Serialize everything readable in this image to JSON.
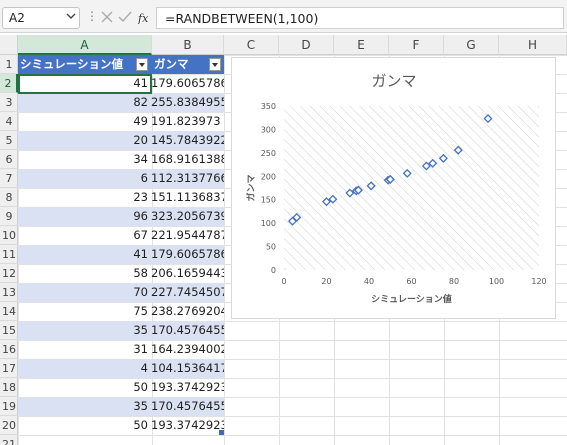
{
  "formula_bar": {
    "name_box": "A2",
    "dots": "⋮",
    "formula": "=RANDBETWEEN(1,100)"
  },
  "columns": [
    "A",
    "B",
    "C",
    "D",
    "E",
    "F",
    "G",
    "H"
  ],
  "rows": [
    "1",
    "2",
    "3",
    "4",
    "5",
    "6",
    "7",
    "8",
    "9",
    "10",
    "11",
    "12",
    "13",
    "14",
    "15",
    "16",
    "17",
    "18",
    "19",
    "20",
    "21"
  ],
  "table": {
    "headers": [
      "シミュレーション値",
      "ガンマ"
    ],
    "rows": [
      [
        "41",
        "179.6065786"
      ],
      [
        "82",
        "255.8384955"
      ],
      [
        "49",
        "191.823973"
      ],
      [
        "20",
        "145.7843922"
      ],
      [
        "34",
        "168.9161388"
      ],
      [
        "6",
        "112.3137766"
      ],
      [
        "23",
        "151.1136837"
      ],
      [
        "96",
        "323.2056739"
      ],
      [
        "67",
        "221.9544787"
      ],
      [
        "41",
        "179.6065786"
      ],
      [
        "58",
        "206.1659443"
      ],
      [
        "70",
        "227.7454507"
      ],
      [
        "75",
        "238.2769204"
      ],
      [
        "35",
        "170.4576455"
      ],
      [
        "31",
        "164.2394002"
      ],
      [
        "4",
        "104.1536417"
      ],
      [
        "50",
        "193.3742923"
      ],
      [
        "35",
        "170.4576455"
      ],
      [
        "50",
        "193.3742923"
      ]
    ]
  },
  "chart_data": {
    "type": "scatter",
    "title": "ガンマ",
    "xlabel": "シミュレーション値",
    "ylabel": "ガンマ",
    "xlim": [
      0,
      120
    ],
    "ylim": [
      0,
      350
    ],
    "xticks": [
      0,
      20,
      40,
      60,
      80,
      100,
      120
    ],
    "yticks": [
      0,
      50,
      100,
      150,
      200,
      250,
      300,
      350
    ],
    "grid": "diagonal-hatch",
    "marker_color": "#4472c4",
    "points": [
      [
        41,
        179.6
      ],
      [
        82,
        255.8
      ],
      [
        49,
        191.8
      ],
      [
        20,
        145.8
      ],
      [
        34,
        168.9
      ],
      [
        6,
        112.3
      ],
      [
        23,
        151.1
      ],
      [
        96,
        323.2
      ],
      [
        67,
        222.0
      ],
      [
        41,
        179.6
      ],
      [
        58,
        206.2
      ],
      [
        70,
        227.7
      ],
      [
        75,
        238.3
      ],
      [
        35,
        170.5
      ],
      [
        31,
        164.2
      ],
      [
        4,
        104.2
      ],
      [
        50,
        193.4
      ],
      [
        35,
        170.5
      ],
      [
        50,
        193.4
      ]
    ]
  }
}
